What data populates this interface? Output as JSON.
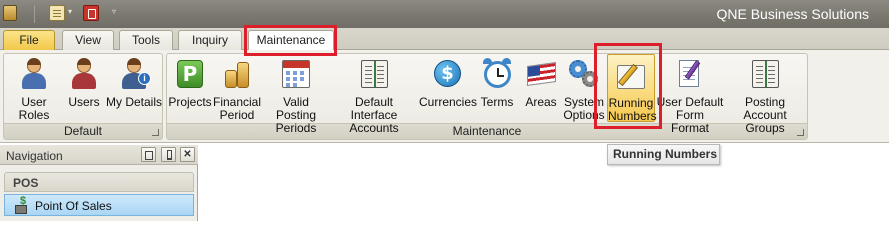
{
  "window": {
    "title": "QNE Business Solutions"
  },
  "tabs": [
    {
      "label": "File"
    },
    {
      "label": "View"
    },
    {
      "label": "Tools"
    },
    {
      "label": "Inquiry"
    },
    {
      "label": "Maintenance",
      "selected": true
    }
  ],
  "ribbon": {
    "groups": {
      "default": {
        "label": "Default",
        "buttons": [
          {
            "label": "User Roles",
            "icon": "user-roles-icon"
          },
          {
            "label": "Users",
            "icon": "users-icon"
          },
          {
            "label": "My Details",
            "icon": "my-details-icon"
          }
        ]
      },
      "maintenance": {
        "label": "Maintenance",
        "buttons": [
          {
            "label": "Projects",
            "icon": "projects-icon"
          },
          {
            "label": "Financial\nPeriod",
            "icon": "financial-period-icon"
          },
          {
            "label": "Valid Posting\nPeriods",
            "icon": "calendar-icon"
          },
          {
            "label": "Default Interface\nAccounts",
            "icon": "ledger-icon"
          },
          {
            "label": "Currencies",
            "icon": "dollar-icon"
          },
          {
            "label": "Terms",
            "icon": "clock-icon"
          },
          {
            "label": "Areas",
            "icon": "flag-icon"
          },
          {
            "label": "System\nOptions",
            "icon": "gears-icon"
          },
          {
            "label": "Running\nNumbers",
            "icon": "running-numbers-icon",
            "selected": true
          },
          {
            "label": "User Default\nForm Format",
            "icon": "form-format-icon"
          },
          {
            "label": "Posting\nAccount Groups",
            "icon": "ledger-icon"
          }
        ]
      }
    }
  },
  "tooltip": {
    "text": "Running Numbers"
  },
  "navigation": {
    "title": "Navigation",
    "close_glyph": "✕",
    "group_label": "POS",
    "items": [
      {
        "label": "Point Of Sales",
        "icon": "point-of-sales-icon",
        "selected": true
      }
    ]
  },
  "colors": {
    "highlight_box": "#dc1f2b",
    "file_tab": "#f2c84a",
    "selected_button": "#f9d97b",
    "nav_selected": "#a9d6f5"
  }
}
